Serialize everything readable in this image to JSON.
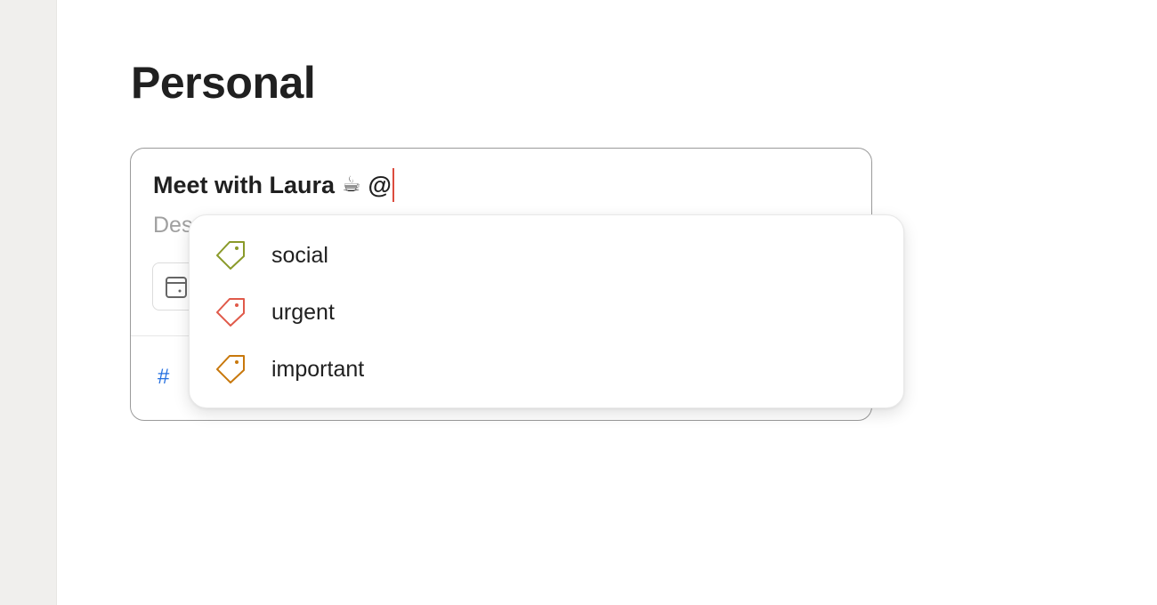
{
  "page": {
    "title": "Personal"
  },
  "task_editor": {
    "title_text": "Meet with Laura",
    "title_emoji": "☕",
    "mention_trigger": "@",
    "description_placeholder": "Description",
    "description_visible": "Des",
    "project_symbol": "#"
  },
  "label_dropdown": {
    "items": [
      {
        "label": "social",
        "icon": "tag-icon",
        "color": "#8a9a2a"
      },
      {
        "label": "urgent",
        "icon": "tag-icon",
        "color": "#e05a4a"
      },
      {
        "label": "important",
        "icon": "tag-icon",
        "color": "#c8780c"
      }
    ]
  }
}
